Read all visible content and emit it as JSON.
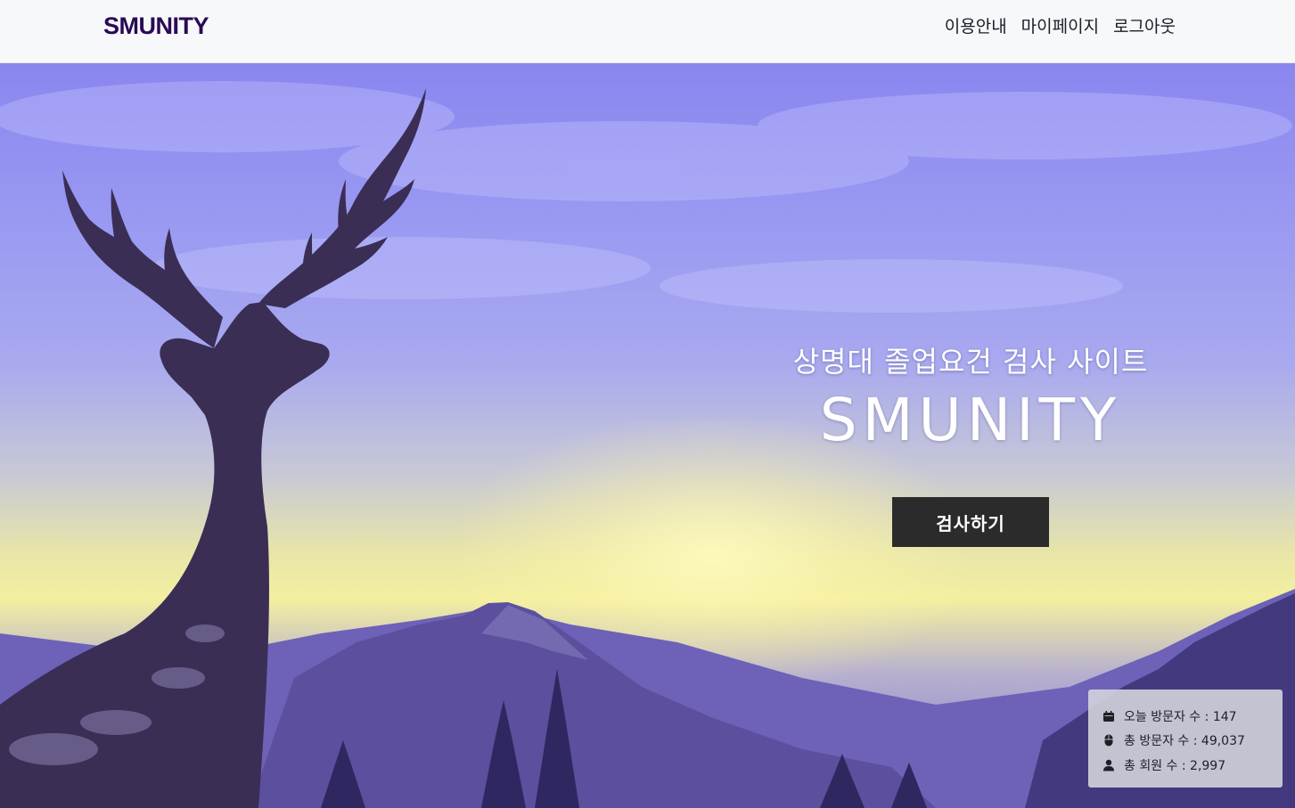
{
  "nav": {
    "logo": "SMUNITY",
    "links": [
      {
        "label": "이용안내"
      },
      {
        "label": "마이페이지"
      },
      {
        "label": "로그아웃"
      }
    ]
  },
  "hero": {
    "subtitle": "상명대 졸업요건 검사 사이트",
    "title": "SMUNITY",
    "button_label": "검사하기"
  },
  "stats": {
    "today_visitors": {
      "icon": "calendar-icon",
      "label": "오늘 방문자 수 : ",
      "value": "147"
    },
    "total_visitors": {
      "icon": "mouse-icon",
      "label": "총 방문자 수 : ",
      "value": "49,037"
    },
    "total_members": {
      "icon": "user-icon",
      "label": "총 회원 수 : ",
      "value": "2,997"
    }
  },
  "colors": {
    "logo": "#2a0a55",
    "button": "#2b2b2b",
    "sky_top": "#8a86ef",
    "sun_glow": "#f3efa0"
  }
}
